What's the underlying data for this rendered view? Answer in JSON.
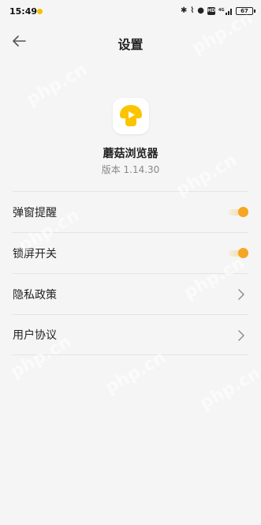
{
  "status_bar": {
    "time": "15:49",
    "network": "4G",
    "hd": "HD",
    "battery": "67"
  },
  "nav": {
    "title": "设置",
    "back_icon": "back-arrow-icon"
  },
  "app": {
    "logo_icon": "mushroom-play-logo",
    "name": "蘑菇浏览器",
    "version": "版本 1.14.30"
  },
  "settings": [
    {
      "label": "弹窗提醒",
      "control": "toggle",
      "on": true
    },
    {
      "label": "锁屏开关",
      "control": "toggle",
      "on": true
    },
    {
      "label": "隐私政策",
      "control": "chevron"
    },
    {
      "label": "用户协议",
      "control": "chevron"
    }
  ],
  "colors": {
    "accent": "#f5a623",
    "logo_yellow": "#fbc400",
    "background": "#f5f5f5"
  },
  "watermark": "php.cn"
}
